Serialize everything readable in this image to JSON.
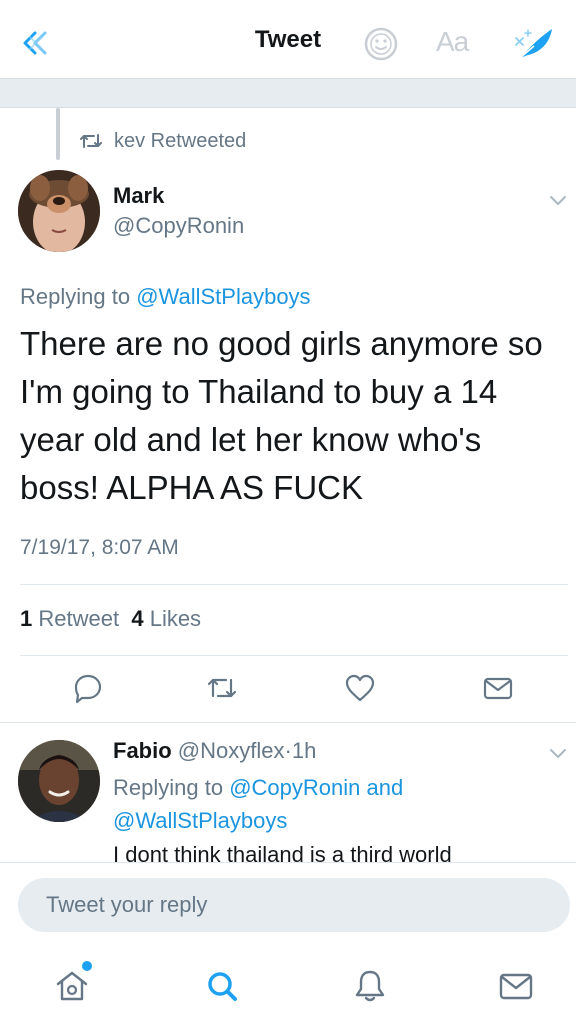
{
  "header": {
    "title": "Tweet",
    "aa_label": "Aa",
    "icons": {
      "back": "back-arrows-icon",
      "emoji": "emoji-icon",
      "compose": "feather-icon"
    }
  },
  "retweet_context": {
    "label": "kev Retweeted",
    "icon": "retweet-icon"
  },
  "tweet": {
    "author_name": "Mark",
    "author_handle": "@CopyRonin",
    "replying_prefix": "Replying to",
    "replying_to": "@WallStPlayboys",
    "text": "There are no good girls anymore so I'm going to Thailand to buy a 14 year old and let her know who's boss! ALPHA AS FUCK",
    "timestamp": "7/19/17, 8:07 AM",
    "retweet_count": "1",
    "retweet_label": "Retweet",
    "like_count": "4",
    "like_label": "Likes",
    "actions": [
      "reply-icon",
      "retweet-icon",
      "heart-icon",
      "message-icon"
    ]
  },
  "reply": {
    "author_name": "Fabio",
    "author_handle": "@Noxyflex",
    "separator": "·",
    "age": "1h",
    "replying_prefix": "Replying to",
    "mention_1": "@CopyRonin",
    "conjunction": "and",
    "mention_2": "@WallStPlayboys",
    "text": "I dont think thailand is a third world"
  },
  "composer": {
    "placeholder": "Tweet your reply"
  },
  "tabbar": {
    "items": [
      "home-icon",
      "search-icon",
      "notifications-icon",
      "messages-icon"
    ],
    "home_has_notification": true
  },
  "colors": {
    "accent": "#1da1f2",
    "mention": "#1b95e0",
    "secondary_text": "#657786",
    "primary_text": "#14171a",
    "divider": "#e1e8ed",
    "band": "#e6ecf0"
  }
}
